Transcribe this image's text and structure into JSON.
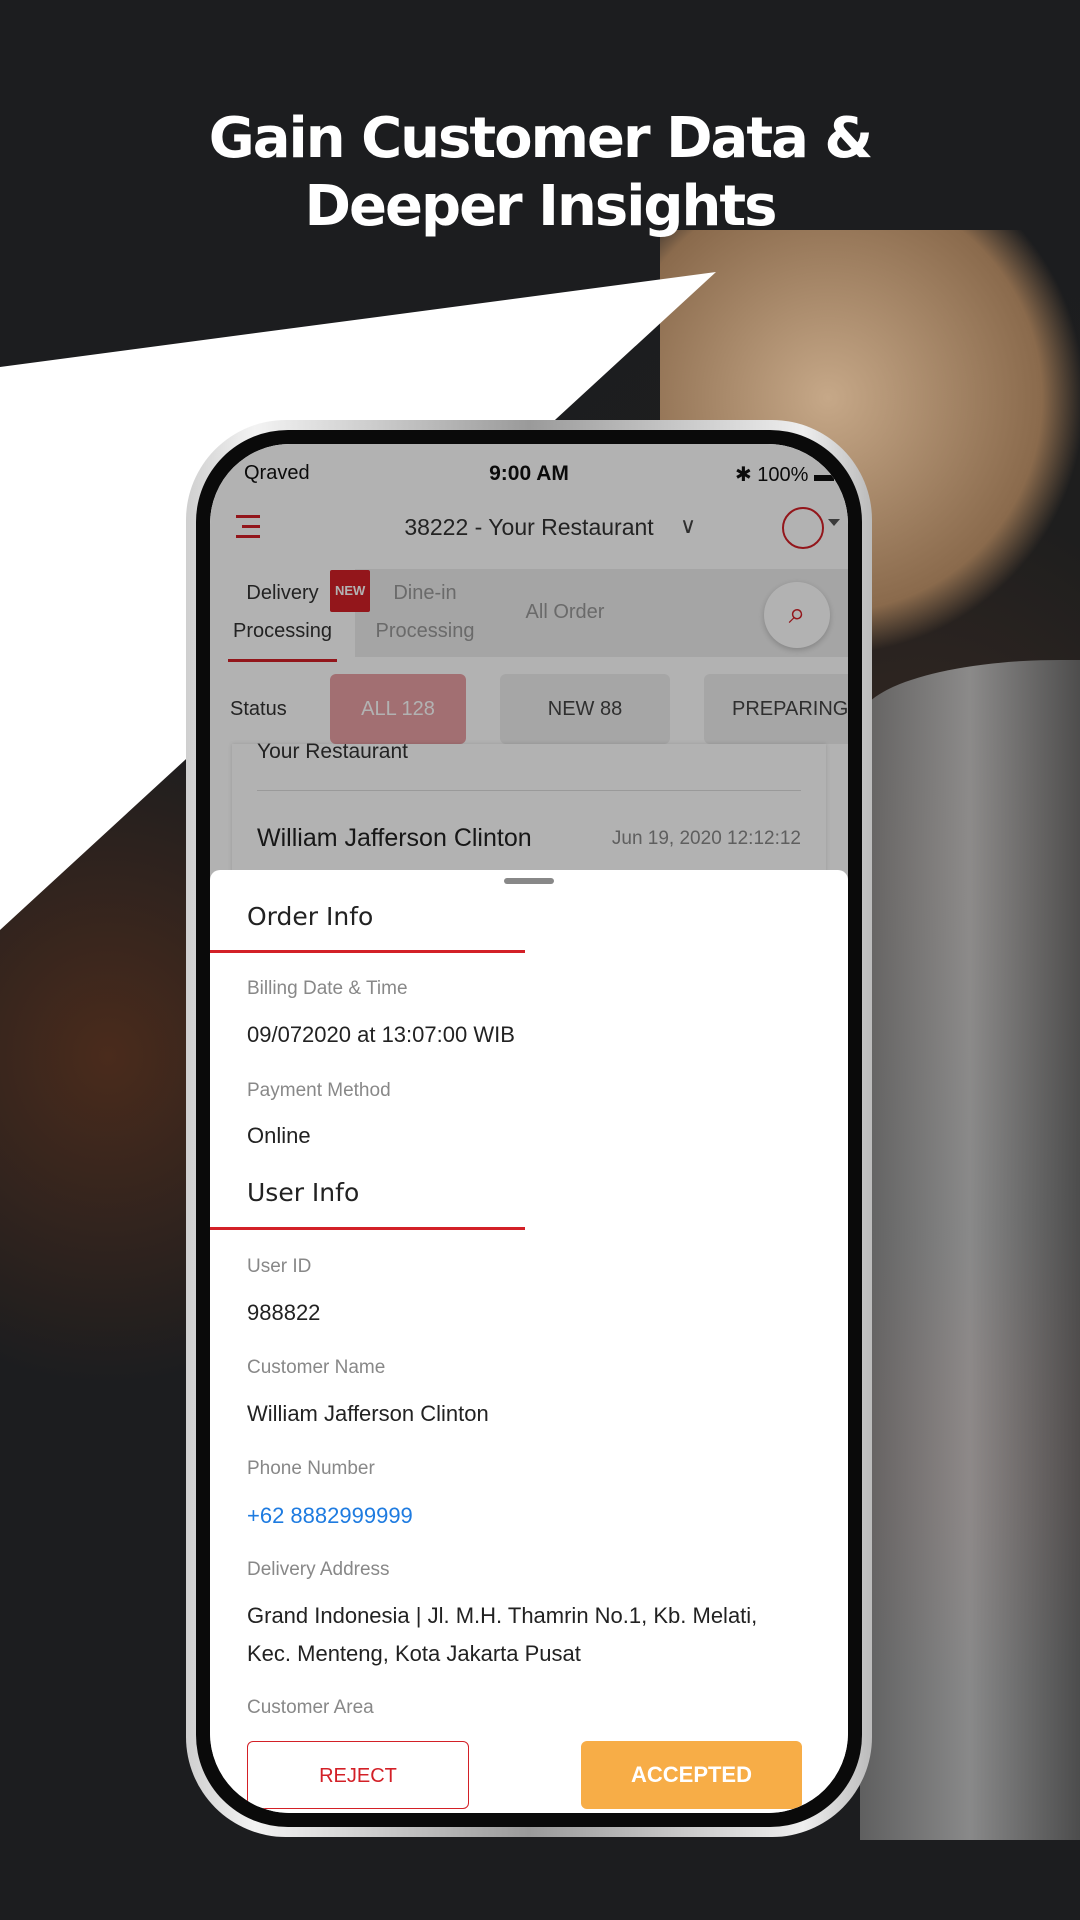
{
  "headline": {
    "line1": "Gain Customer Data &",
    "line2": "Deeper Insights"
  },
  "status_bar": {
    "carrier": "Qraved",
    "time": "9:00 AM",
    "battery": "100%"
  },
  "header": {
    "restaurant": "38222 - Your Restaurant"
  },
  "tabs": [
    {
      "label": "Delivery Processing",
      "badge": "NEW",
      "active": true
    },
    {
      "label": "Dine-in Processing"
    },
    {
      "label": "All Order"
    }
  ],
  "status": {
    "label": "Status",
    "chips": [
      {
        "label": "ALL 128",
        "active": true
      },
      {
        "label": "NEW 88"
      },
      {
        "label": "PREPARING"
      }
    ]
  },
  "order_card": {
    "restaurant": "Your Restaurant",
    "customer": "William Jafferson Clinton",
    "date": "Jun 19, 2020 12:12:12"
  },
  "order_info": {
    "title": "Order Info",
    "billing_label": "Billing Date & Time",
    "billing_value": "09/072020 at 13:07:00 WIB",
    "payment_label": "Payment Method",
    "payment_value": "Online"
  },
  "user_info": {
    "title": "User Info",
    "id_label": "User ID",
    "id_value": "988822",
    "name_label": "Customer Name",
    "name_value": "William Jafferson Clinton",
    "phone_label": "Phone Number",
    "phone_value": "+62 8882999999",
    "address_label": "Delivery Address",
    "address_value": "Grand Indonesia | Jl. M.H. Thamrin No.1, Kb. Melati, Kec. Menteng, Kota Jakarta Pusat",
    "area_label": "Customer Area"
  },
  "actions": {
    "reject": "REJECT",
    "accept": "ACCEPTED"
  },
  "colors": {
    "accent": "#d32027",
    "accept": "#f7ad47",
    "link": "#1e7be0"
  }
}
